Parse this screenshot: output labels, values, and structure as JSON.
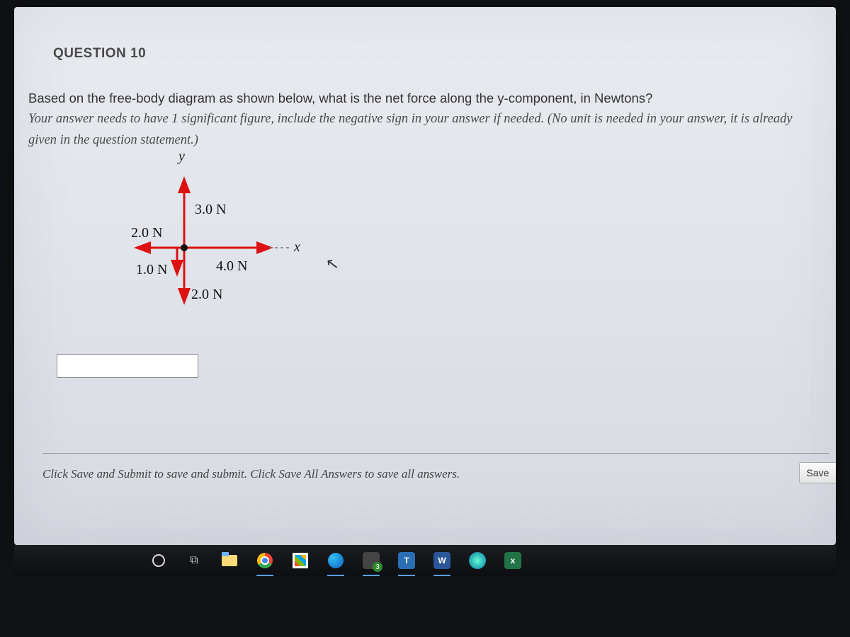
{
  "question": {
    "header": "QUESTION 10",
    "prompt_main": "Based on the free-body diagram as shown below, what is the net force along the y-component, in Newtons?",
    "prompt_note": "Your answer needs to have 1 significant figure, include the negative sign in your answer if needed. (No unit is needed in your answer, it is already given in the question statement.)"
  },
  "diagram": {
    "axis_y": "y",
    "axis_x": "x",
    "force_up": "3.0 N",
    "force_left": "2.0 N",
    "force_down_small": "1.0 N",
    "force_right": "4.0 N",
    "force_down_large": "2.0 N"
  },
  "answer": {
    "value": "",
    "placeholder": ""
  },
  "footer": {
    "hint": "Click Save and Submit to save and submit. Click Save All Answers to save all answers.",
    "save_label": "Save"
  },
  "taskbar": {
    "badge_3": "3",
    "letter_t": "T",
    "letter_w": "W",
    "letter_x": "x"
  }
}
